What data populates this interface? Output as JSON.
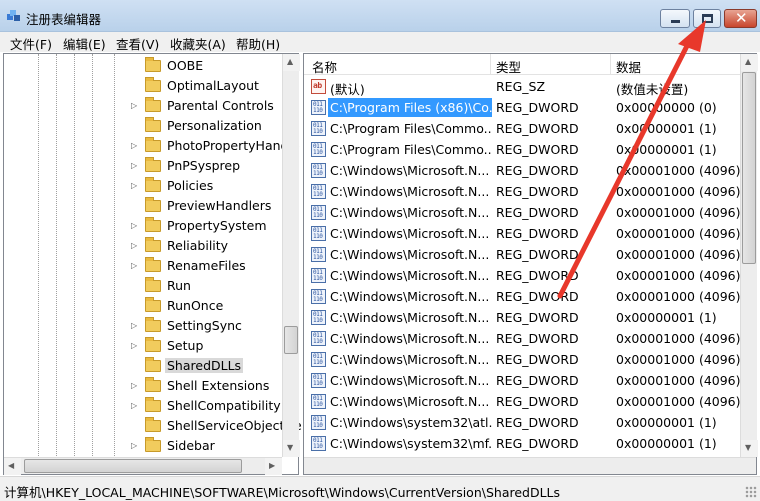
{
  "window": {
    "title": "注册表编辑器",
    "controls": [
      "minimize",
      "maximize",
      "close"
    ],
    "close_glyph": "✕"
  },
  "menu": [
    "文件(F)",
    "编辑(E)",
    "查看(V)",
    "收藏夹(A)",
    "帮助(H)"
  ],
  "tree": {
    "items": [
      {
        "label": "OOBE",
        "expandable": false
      },
      {
        "label": "OptimalLayout",
        "expandable": false
      },
      {
        "label": "Parental Controls",
        "expandable": true
      },
      {
        "label": "Personalization",
        "expandable": false
      },
      {
        "label": "PhotoPropertyHandle",
        "expandable": true
      },
      {
        "label": "PnPSysprep",
        "expandable": true
      },
      {
        "label": "Policies",
        "expandable": true
      },
      {
        "label": "PreviewHandlers",
        "expandable": false
      },
      {
        "label": "PropertySystem",
        "expandable": true
      },
      {
        "label": "Reliability",
        "expandable": true
      },
      {
        "label": "RenameFiles",
        "expandable": true
      },
      {
        "label": "Run",
        "expandable": false
      },
      {
        "label": "RunOnce",
        "expandable": false
      },
      {
        "label": "SettingSync",
        "expandable": true
      },
      {
        "label": "Setup",
        "expandable": true
      },
      {
        "label": "SharedDLLs",
        "expandable": false,
        "selected": true
      },
      {
        "label": "Shell Extensions",
        "expandable": true
      },
      {
        "label": "ShellCompatibility",
        "expandable": true
      },
      {
        "label": "ShellServiceObjectDe",
        "expandable": false
      },
      {
        "label": "Sidebar",
        "expandable": true
      }
    ]
  },
  "list": {
    "columns": [
      "名称",
      "类型",
      "数据"
    ],
    "rows": [
      {
        "icon": "string-value-icon",
        "glyph": "ab",
        "name": "(默认)",
        "type": "REG_SZ",
        "data": "(数值未设置)"
      },
      {
        "icon": "dword-value-icon",
        "glyph": "011 110",
        "name": "C:\\Program Files (x86)\\Co...",
        "type": "REG_DWORD",
        "data": "0x00000000 (0)",
        "highlight": true
      },
      {
        "icon": "dword-value-icon",
        "glyph": "011 110",
        "name": "C:\\Program Files\\Commo...",
        "type": "REG_DWORD",
        "data": "0x00000001 (1)"
      },
      {
        "icon": "dword-value-icon",
        "glyph": "011 110",
        "name": "C:\\Program Files\\Commo...",
        "type": "REG_DWORD",
        "data": "0x00000001 (1)"
      },
      {
        "icon": "dword-value-icon",
        "glyph": "011 110",
        "name": "C:\\Windows\\Microsoft.N...",
        "type": "REG_DWORD",
        "data": "0x00001000 (4096)"
      },
      {
        "icon": "dword-value-icon",
        "glyph": "011 110",
        "name": "C:\\Windows\\Microsoft.N...",
        "type": "REG_DWORD",
        "data": "0x00001000 (4096)"
      },
      {
        "icon": "dword-value-icon",
        "glyph": "011 110",
        "name": "C:\\Windows\\Microsoft.N...",
        "type": "REG_DWORD",
        "data": "0x00001000 (4096)"
      },
      {
        "icon": "dword-value-icon",
        "glyph": "011 110",
        "name": "C:\\Windows\\Microsoft.N...",
        "type": "REG_DWORD",
        "data": "0x00001000 (4096)"
      },
      {
        "icon": "dword-value-icon",
        "glyph": "011 110",
        "name": "C:\\Windows\\Microsoft.N...",
        "type": "REG_DWORD",
        "data": "0x00001000 (4096)"
      },
      {
        "icon": "dword-value-icon",
        "glyph": "011 110",
        "name": "C:\\Windows\\Microsoft.N...",
        "type": "REG_DWORD",
        "data": "0x00001000 (4096)"
      },
      {
        "icon": "dword-value-icon",
        "glyph": "011 110",
        "name": "C:\\Windows\\Microsoft.N...",
        "type": "REG_DWORD",
        "data": "0x00001000 (4096)"
      },
      {
        "icon": "dword-value-icon",
        "glyph": "011 110",
        "name": "C:\\Windows\\Microsoft.N...",
        "type": "REG_DWORD",
        "data": "0x00000001 (1)"
      },
      {
        "icon": "dword-value-icon",
        "glyph": "011 110",
        "name": "C:\\Windows\\Microsoft.N...",
        "type": "REG_DWORD",
        "data": "0x00001000 (4096)"
      },
      {
        "icon": "dword-value-icon",
        "glyph": "011 110",
        "name": "C:\\Windows\\Microsoft.N...",
        "type": "REG_DWORD",
        "data": "0x00001000 (4096)"
      },
      {
        "icon": "dword-value-icon",
        "glyph": "011 110",
        "name": "C:\\Windows\\Microsoft.N...",
        "type": "REG_DWORD",
        "data": "0x00001000 (4096)"
      },
      {
        "icon": "dword-value-icon",
        "glyph": "011 110",
        "name": "C:\\Windows\\Microsoft.N...",
        "type": "REG_DWORD",
        "data": "0x00001000 (4096)"
      },
      {
        "icon": "dword-value-icon",
        "glyph": "011 110",
        "name": "C:\\Windows\\system32\\atl...",
        "type": "REG_DWORD",
        "data": "0x00000001 (1)"
      },
      {
        "icon": "dword-value-icon",
        "glyph": "011 110",
        "name": "C:\\Windows\\system32\\mf...",
        "type": "REG_DWORD",
        "data": "0x00000001 (1)"
      }
    ]
  },
  "statusbar": {
    "path": "计算机\\HKEY_LOCAL_MACHINE\\SOFTWARE\\Microsoft\\Windows\\CurrentVersion\\SharedDLLs"
  },
  "annotation": {
    "color": "#e8382b"
  },
  "scroll_glyphs": {
    "up": "▲",
    "down": "▼",
    "left": "◀",
    "right": "▶",
    "expander": "▷"
  }
}
